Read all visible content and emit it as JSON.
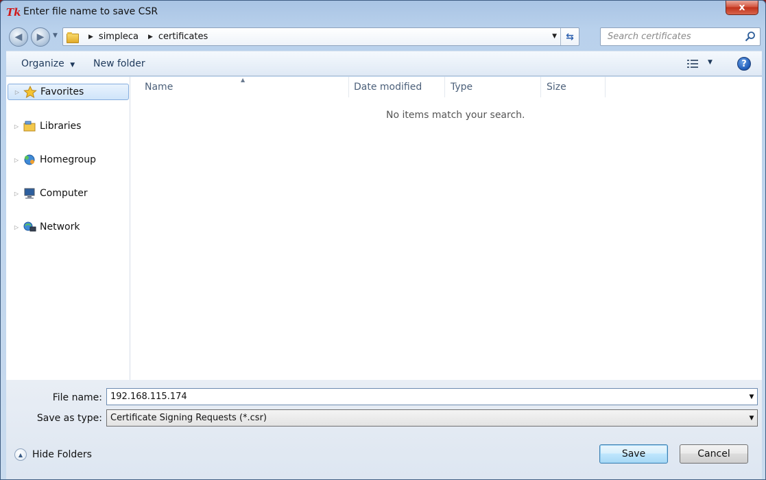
{
  "window": {
    "title": "Enter file name to save CSR",
    "close_label": "x"
  },
  "address": {
    "crumbs": [
      "simpleca",
      "certificates"
    ],
    "search_placeholder": "Search certificates"
  },
  "toolbar": {
    "organize": "Organize",
    "new_folder": "New folder"
  },
  "nav": {
    "items": [
      {
        "label": "Favorites",
        "icon": "star-icon"
      },
      {
        "label": "Libraries",
        "icon": "libraries-icon"
      },
      {
        "label": "Homegroup",
        "icon": "homegroup-icon"
      },
      {
        "label": "Computer",
        "icon": "computer-icon"
      },
      {
        "label": "Network",
        "icon": "network-icon"
      }
    ]
  },
  "list": {
    "columns": [
      "Name",
      "Date modified",
      "Type",
      "Size"
    ],
    "empty_message": "No items match your search."
  },
  "form": {
    "file_name_label": "File name:",
    "file_name_value": "192.168.115.174",
    "type_label": "Save as type:",
    "type_value": "Certificate Signing Requests (*.csr)"
  },
  "footer": {
    "hide_folders": "Hide Folders",
    "save": "Save",
    "cancel": "Cancel"
  },
  "colors": {
    "accent": "#3c7fb1",
    "close": "#c0321b",
    "nav_selected": "#cfe4fa"
  }
}
